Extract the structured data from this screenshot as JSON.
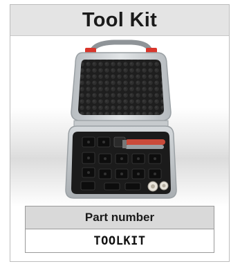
{
  "card": {
    "title": "Tool Kit"
  },
  "product_image": {
    "subject": "carrying case with crimper and interchangeable dies",
    "colors": {
      "case_shell": "#cfd3d6",
      "foam": "#1c1c1c",
      "latch": "#d9362b",
      "handle_grip": "#c94a3a"
    }
  },
  "part_table": {
    "header": "Part number",
    "value": "TOOLKIT"
  }
}
